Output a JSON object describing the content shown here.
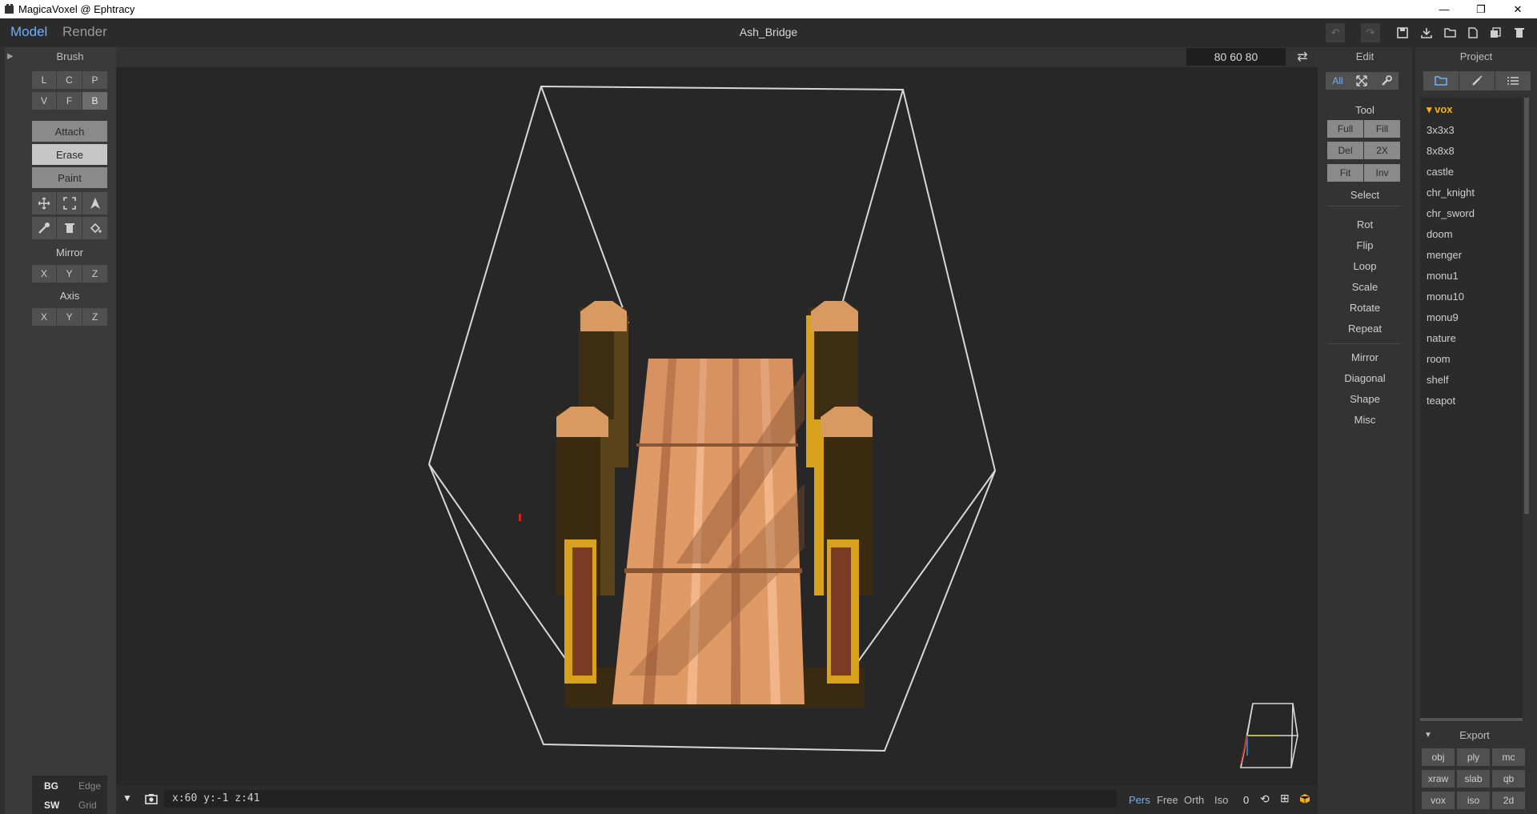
{
  "window": {
    "title": "MagicaVoxel @ Ephtracy",
    "minimize": "—",
    "restore": "❐",
    "close": "✕"
  },
  "menubar": {
    "model_tab": "Model",
    "render_tab": "Render",
    "file_name": "Ash_Bridge"
  },
  "brush": {
    "header": "Brush",
    "modes_row1": [
      "L",
      "C",
      "P"
    ],
    "modes_row2": [
      "V",
      "F",
      "B"
    ],
    "attach": "Attach",
    "erase": "Erase",
    "paint": "Paint",
    "mirror_label": "Mirror",
    "mirror_axes": [
      "X",
      "Y",
      "Z"
    ],
    "axis_label": "Axis",
    "axis_axes": [
      "X",
      "Y",
      "Z"
    ]
  },
  "bottom_left": {
    "bg": "BG",
    "edge": "Edge",
    "sw": "SW",
    "grid": "Grid"
  },
  "viewport": {
    "dimensions": "80 60 80"
  },
  "status": {
    "coords": "x:60   y:-1   z:41",
    "pers": "Pers",
    "free": "Free",
    "orth": "Orth",
    "iso": "Iso",
    "zero": "0"
  },
  "edit": {
    "header": "Edit",
    "all": "All",
    "tool_label": "Tool",
    "full": "Full",
    "fill": "Fill",
    "del": "Del",
    "x2": "2X",
    "fit": "Fit",
    "inv": "Inv",
    "select": "Select",
    "rot": "Rot",
    "flip": "Flip",
    "loop": "Loop",
    "scale": "Scale",
    "rotate": "Rotate",
    "repeat": "Repeat",
    "mirror": "Mirror",
    "diagonal": "Diagonal",
    "shape": "Shape",
    "misc": "Misc"
  },
  "project": {
    "header": "Project",
    "folder": "▾ vox",
    "items": [
      "3x3x3",
      "8x8x8",
      "castle",
      "chr_knight",
      "chr_sword",
      "doom",
      "menger",
      "monu1",
      "monu10",
      "monu9",
      "nature",
      "room",
      "shelf",
      "teapot"
    ]
  },
  "export": {
    "header": "Export",
    "row1": [
      "obj",
      "ply",
      "mc"
    ],
    "row2": [
      "xraw",
      "slab",
      "qb"
    ],
    "row3": [
      "vox",
      "iso",
      "2d"
    ]
  },
  "colors": {
    "accent": "#6fb0ff",
    "folder": "#f0b020",
    "wood_light": "#e8a06a",
    "wood_dark": "#4a3517",
    "rail_gold": "#d9a21e"
  }
}
